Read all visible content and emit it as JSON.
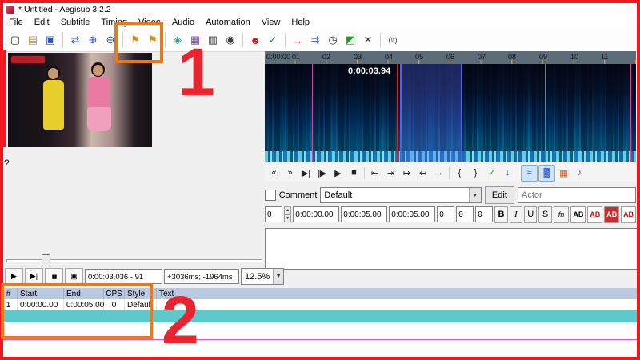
{
  "window": {
    "title": "* Untitled - Aegisub 3.2.2"
  },
  "menu": {
    "items": [
      "File",
      "Edit",
      "Subtitle",
      "Timing",
      "Video",
      "Audio",
      "Automation",
      "View",
      "Help"
    ]
  },
  "toolbar": {
    "icons": [
      {
        "name": "new-subtitles-icon",
        "glyph": "▢"
      },
      {
        "name": "open-subtitles-icon",
        "glyph": "▤"
      },
      {
        "name": "save-subtitles-icon",
        "glyph": "▣"
      },
      {
        "name": "jump-to-icon",
        "glyph": "⇄"
      },
      {
        "name": "zoom-in-icon",
        "glyph": "⊕"
      },
      {
        "name": "zoom-out-icon",
        "glyph": "⊖"
      },
      {
        "name": "key-icon-left",
        "glyph": "⚑"
      },
      {
        "name": "key-icon-right",
        "glyph": "⚑"
      },
      {
        "name": "styles-manager-icon",
        "glyph": "◈"
      },
      {
        "name": "video-details-icon",
        "glyph": "▦"
      },
      {
        "name": "film-strip-icon",
        "glyph": "▥"
      },
      {
        "name": "camera-icon",
        "glyph": "◉"
      },
      {
        "name": "automation-icon",
        "glyph": "☻"
      },
      {
        "name": "spellcheck-icon",
        "glyph": "✓"
      },
      {
        "name": "shift-times-icon",
        "glyph": "→"
      },
      {
        "name": "timing-postprocessor-icon",
        "glyph": "⇉"
      },
      {
        "name": "clock-icon",
        "glyph": "◷"
      },
      {
        "name": "kanji-timer-icon",
        "glyph": "◩"
      },
      {
        "name": "options-icon",
        "glyph": "✕"
      },
      {
        "name": "tab-glyph-button",
        "glyph": "(\\t)"
      }
    ]
  },
  "video_panel": {
    "help_glyph": "?"
  },
  "audio": {
    "ruler": [
      "0:00:00",
      "01",
      "02",
      "03",
      "04",
      "05",
      "06",
      "07",
      "08",
      "09",
      "10",
      "11"
    ],
    "cursor_time": "0:00:03.94",
    "toolbar": [
      {
        "name": "prev-line-icon",
        "glyph": "«"
      },
      {
        "name": "next-line-icon",
        "glyph": "»"
      },
      {
        "name": "play-selection-icon",
        "glyph": "▶|"
      },
      {
        "name": "play-line-icon",
        "glyph": "|▶"
      },
      {
        "name": "play-icon",
        "glyph": "▶"
      },
      {
        "name": "stop-icon",
        "glyph": "■"
      },
      {
        "name": "play-500-before-icon",
        "glyph": "⇤"
      },
      {
        "name": "play-500-after-icon",
        "glyph": "⇥"
      },
      {
        "name": "play-first-500-icon",
        "glyph": "↦"
      },
      {
        "name": "play-last-500-icon",
        "glyph": "↤"
      },
      {
        "name": "play-to-end-icon",
        "glyph": "→"
      },
      {
        "name": "lead-in-icon",
        "glyph": "{"
      },
      {
        "name": "lead-out-icon",
        "glyph": "}"
      },
      {
        "name": "commit-icon",
        "glyph": "✓"
      },
      {
        "name": "goto-selection-icon",
        "glyph": "↓"
      },
      {
        "name": "waveform-mode-icon",
        "glyph": "≈"
      },
      {
        "name": "spectrum-mode-icon",
        "glyph": "▓"
      },
      {
        "name": "karaoke-syllables-icon",
        "glyph": "▦"
      },
      {
        "name": "karaoke-mode-icon",
        "glyph": "♪"
      }
    ]
  },
  "edit": {
    "comment_label": "Comment",
    "style_selected": "Default",
    "edit_button_label": "Edit",
    "actor_placeholder": "Actor",
    "layer_value": "0",
    "start_value": "0:00:00.00",
    "end_value": "0:00:05.00",
    "duration_value": "0:00:05.00",
    "margin_values": [
      "0",
      "0",
      "0"
    ],
    "format_labels": [
      "B",
      "I",
      "U",
      "S",
      "fn"
    ],
    "color_button_label": "AB",
    "text_value": ""
  },
  "video_controls": {
    "buttons": [
      {
        "name": "play-button",
        "glyph": "▶"
      },
      {
        "name": "play-line-button",
        "glyph": "▶|"
      },
      {
        "name": "pause-button",
        "glyph": "▮▮"
      },
      {
        "name": "autoseek-toggle-icon",
        "glyph": "▣"
      }
    ],
    "time_display": "0:00:03.036 - 91",
    "shift_display": "+3036ms; -1964ms",
    "zoom_value": "12.5%"
  },
  "grid": {
    "headers": [
      "#",
      "Start",
      "End",
      "CPS",
      "Style",
      "Text"
    ],
    "rows": [
      {
        "line": "1",
        "start": "0:00:00.00",
        "end": "0:00:05.00",
        "cps": "0",
        "style": "Default",
        "text": ""
      }
    ]
  },
  "annotations": {
    "step_1": "1",
    "step_2": "2"
  },
  "glyphs": {
    "dropdown": "▼",
    "spin_up": "▲",
    "spin_down": "▼"
  },
  "colors": {
    "annotation_red": "#e8242e",
    "annotation_orange": "#e8791d",
    "frame_red": "#f01820",
    "selection_blue": "#5560e8",
    "grid_header": "#b9c9e0",
    "grid_band": "#5ec9cb"
  }
}
